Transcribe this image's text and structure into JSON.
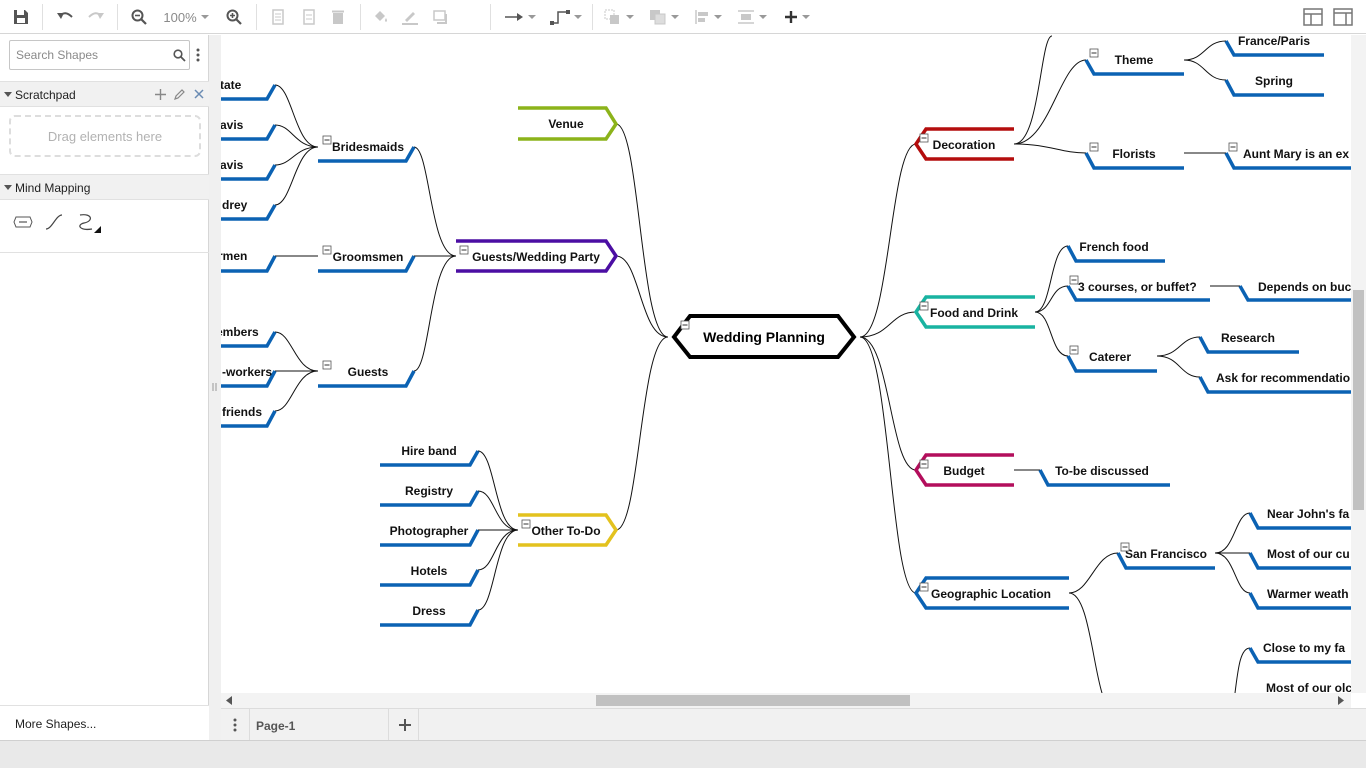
{
  "toolbar": {
    "zoom_label": "100%"
  },
  "sidebar": {
    "search_placeholder": "Search Shapes",
    "scratchpad_title": "Scratchpad",
    "drop_hint": "Drag elements here",
    "mind_mapping_title": "Mind Mapping",
    "more_shapes": "More Shapes..."
  },
  "pages": {
    "current": "Page-1"
  },
  "colors": {
    "branch_blue": "#0b62b3",
    "venue": "#8cb31a",
    "guests_party": "#4b0ea3",
    "other_todo": "#e3c21e",
    "decoration": "#b40d0d",
    "food": "#19b3a1",
    "budget": "#b30e5c",
    "geo": "#0b62b3"
  },
  "mindmap": {
    "central": "Wedding Planning",
    "left": {
      "venue": "Venue",
      "guests_party": "Guests/Wedding Party",
      "bridesmaids": "Bridesmaids",
      "bridesmaid_leaves": [
        "tate",
        "avis",
        "avis",
        "drey"
      ],
      "groomsmen": "Groomsmen",
      "groomsmen_leaf": "rmen",
      "guests": "Guests",
      "guest_leaves": [
        "embers",
        "-workers",
        "friends"
      ],
      "other_todo": "Other To-Do",
      "todo_items": [
        "Hire band",
        "Registry",
        "Photographer",
        "Hotels",
        "Dress"
      ]
    },
    "right": {
      "decoration": "Decoration",
      "theme": "Theme",
      "theme_items": [
        "France/Paris",
        "Spring"
      ],
      "florists": "Florists",
      "florist_item": "Aunt Mary is an ex",
      "food": "Food and Drink",
      "french_food": "French food",
      "courses": "3 courses, or buffet?",
      "depends": "Depends on buc",
      "caterer": "Caterer",
      "caterer_items": [
        "Research",
        "Ask for recommendatio"
      ],
      "budget": "Budget",
      "budget_item": "To-be discussed",
      "geo": "Geographic Location",
      "sf": "San Francisco",
      "sf_items": [
        "Near John's fa",
        "Most of our cu",
        "Warmer weath"
      ],
      "other_loc_items": [
        "Close to my fa",
        "Most of our olc"
      ]
    }
  }
}
